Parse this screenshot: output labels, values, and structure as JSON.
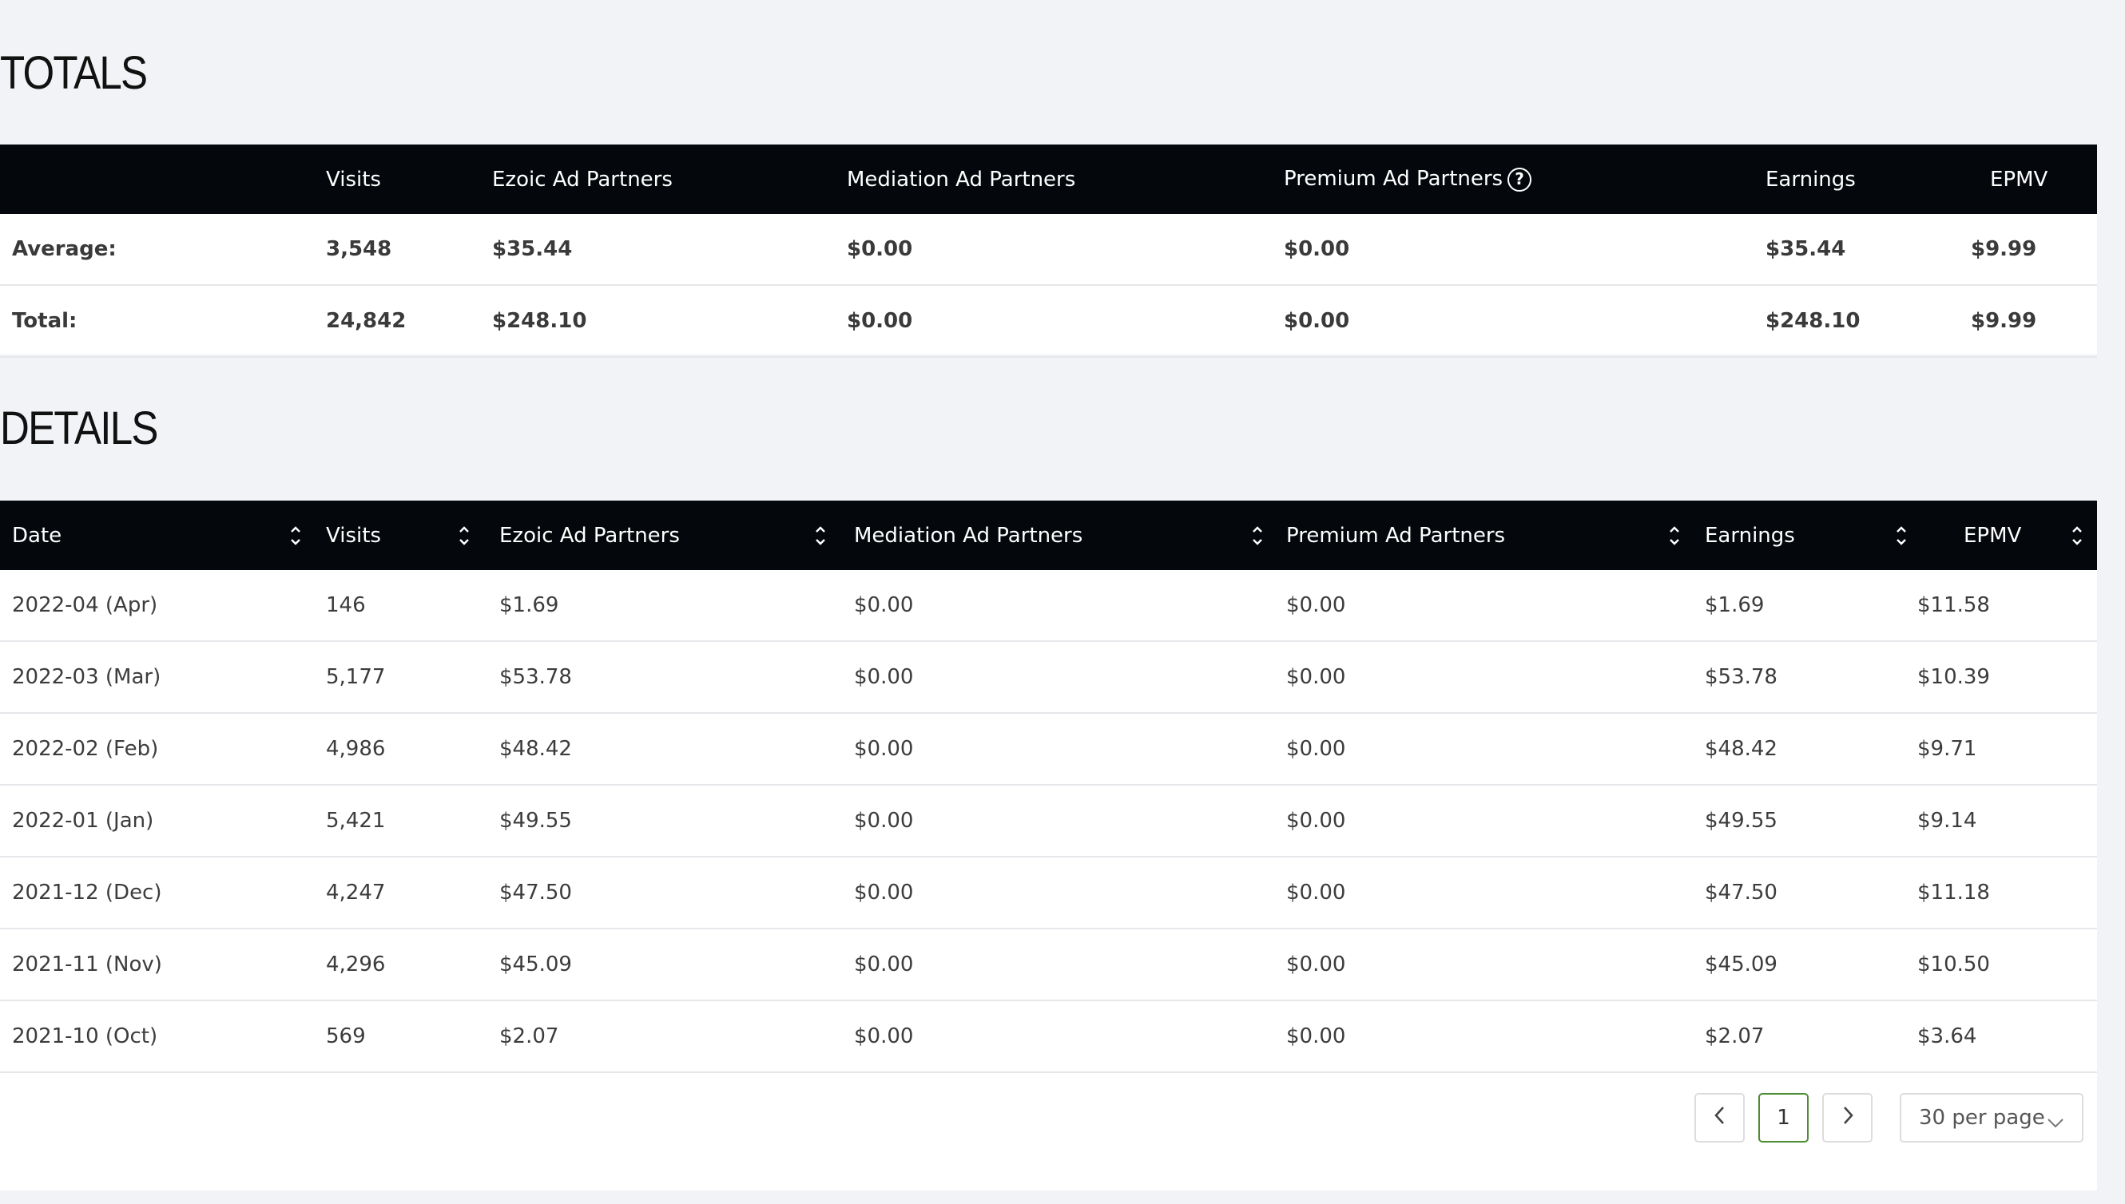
{
  "totals": {
    "title": "TOTALS",
    "headers": [
      "",
      "Visits",
      "Ezoic Ad Partners",
      "Mediation Ad Partners",
      "Premium Ad Partners",
      "Earnings",
      "EPMV"
    ],
    "rows": [
      {
        "label": "Average:",
        "visits": "3,548",
        "ezoic": "$35.44",
        "mediation": "$0.00",
        "premium": "$0.00",
        "earnings": "$35.44",
        "epmv": "$9.99"
      },
      {
        "label": "Total:",
        "visits": "24,842",
        "ezoic": "$248.10",
        "mediation": "$0.00",
        "premium": "$0.00",
        "earnings": "$248.10",
        "epmv": "$9.99"
      }
    ],
    "help_icon": "question-circle-icon"
  },
  "details": {
    "title": "DETAILS",
    "headers": [
      "Date",
      "Visits",
      "Ezoic Ad Partners",
      "Mediation Ad Partners",
      "Premium Ad Partners",
      "Earnings",
      "EPMV"
    ],
    "rows": [
      {
        "date": "2022-04 (Apr)",
        "visits": "146",
        "ezoic": "$1.69",
        "mediation": "$0.00",
        "premium": "$0.00",
        "earnings": "$1.69",
        "epmv": "$11.58"
      },
      {
        "date": "2022-03 (Mar)",
        "visits": "5,177",
        "ezoic": "$53.78",
        "mediation": "$0.00",
        "premium": "$0.00",
        "earnings": "$53.78",
        "epmv": "$10.39"
      },
      {
        "date": "2022-02 (Feb)",
        "visits": "4,986",
        "ezoic": "$48.42",
        "mediation": "$0.00",
        "premium": "$0.00",
        "earnings": "$48.42",
        "epmv": "$9.71"
      },
      {
        "date": "2022-01 (Jan)",
        "visits": "5,421",
        "ezoic": "$49.55",
        "mediation": "$0.00",
        "premium": "$0.00",
        "earnings": "$49.55",
        "epmv": "$9.14"
      },
      {
        "date": "2021-12 (Dec)",
        "visits": "4,247",
        "ezoic": "$47.50",
        "mediation": "$0.00",
        "premium": "$0.00",
        "earnings": "$47.50",
        "epmv": "$11.18"
      },
      {
        "date": "2021-11 (Nov)",
        "visits": "4,296",
        "ezoic": "$45.09",
        "mediation": "$0.00",
        "premium": "$0.00",
        "earnings": "$45.09",
        "epmv": "$10.50"
      },
      {
        "date": "2021-10 (Oct)",
        "visits": "569",
        "ezoic": "$2.07",
        "mediation": "$0.00",
        "premium": "$0.00",
        "earnings": "$2.07",
        "epmv": "$3.64"
      }
    ]
  },
  "pagination": {
    "current_page": "1",
    "per_page": "30 per page",
    "prev_icon": "chevron-left-icon",
    "next_icon": "chevron-right-icon"
  },
  "colors": {
    "header_bg": "#04080c",
    "page_bg": "#f2f3f7",
    "active_page_border": "#4c8d33"
  }
}
